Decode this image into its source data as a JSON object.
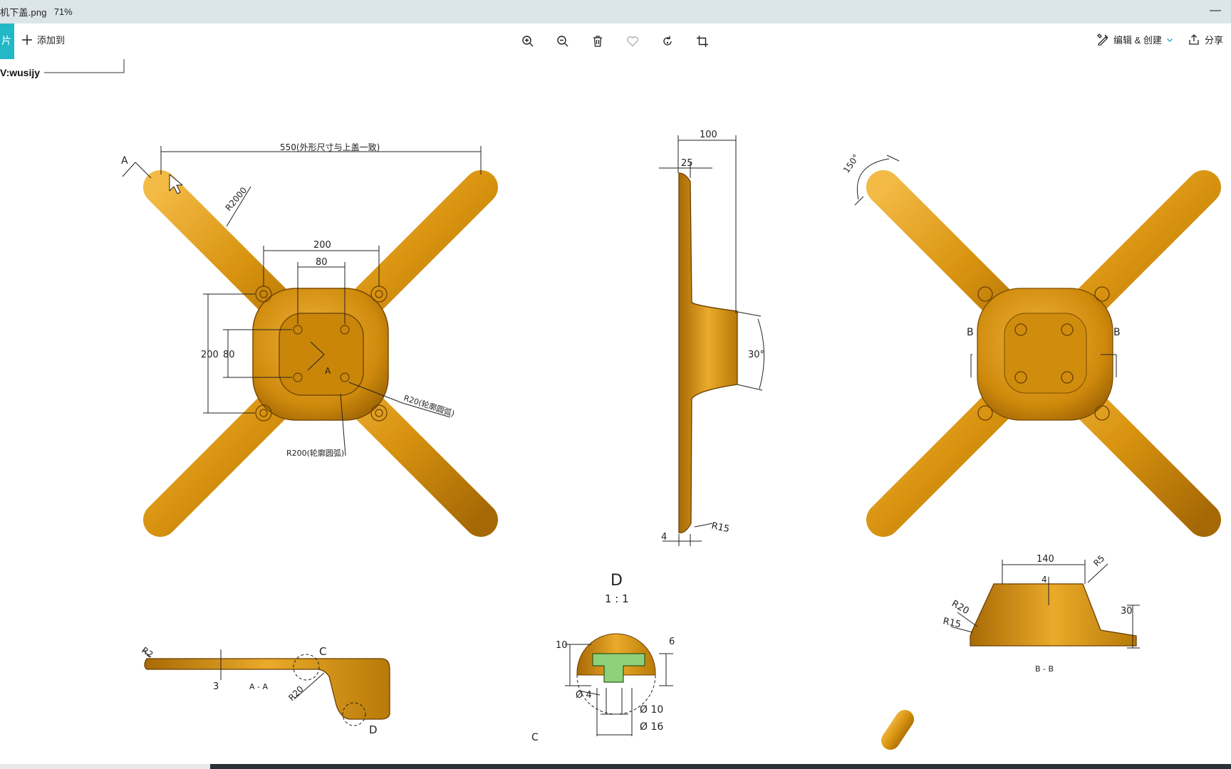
{
  "window": {
    "title": "机下盖.png",
    "zoom": "71%",
    "minimize": "—"
  },
  "toolbar": {
    "accent_glyph": "片",
    "add_label": "添加到",
    "edit_label": "编辑 & 创建",
    "share_label": "分享"
  },
  "icons": {
    "zoom_in": "zoom-in-icon",
    "zoom_out": "zoom-out-icon",
    "delete": "trash-icon",
    "favorite": "heart-icon",
    "rotate": "rotate-icon",
    "crop": "crop-icon",
    "edit": "edit-create-icon",
    "share": "share-icon",
    "chevron": "chevron-down-icon"
  },
  "colors": {
    "accent": "#23b8c8",
    "part": "#d4900f",
    "part_dark": "#a86a05",
    "part_light": "#f0b640"
  },
  "drawing": {
    "watermark": "V:wusijy",
    "top_view": {
      "width_dim": "550(外形尺寸与上盖一致)",
      "radius_arm": "R2000",
      "hole_spacing_outer_h": "200",
      "hole_spacing_inner_h": "80",
      "hole_spacing_outer_v": "200",
      "hole_spacing_inner_v": "80",
      "radius_r20": "R20(轮廓圆弧)",
      "radius_r200": "R200(轮廓圆弧)",
      "section_a": "A",
      "section_a_center": "A"
    },
    "side_view": {
      "height_dim": "100",
      "flange_dim": "25",
      "angle": "30°",
      "thickness": "4",
      "radius": "R15"
    },
    "right_view": {
      "angle": "150°",
      "section_b_left": "B",
      "section_b_right": "B"
    },
    "section_aa": {
      "label": "A - A",
      "radius_r2": "R2",
      "thickness": "3",
      "radius_r20": "R20",
      "detail_c": "C",
      "detail_d": "D"
    },
    "detail_d": {
      "title": "D",
      "scale": "1 : 1",
      "dim_10": "10",
      "dim_6": "6",
      "dim_d4": "Ø 4",
      "dim_d10": "Ø 10",
      "dim_d16": "Ø 16",
      "corner_c": "C"
    },
    "section_bb": {
      "label": "B - B",
      "width": "140",
      "wall": "4",
      "radius_r5": "R5",
      "radius_r20": "R20",
      "radius_r15": "R15",
      "height": "30"
    }
  }
}
